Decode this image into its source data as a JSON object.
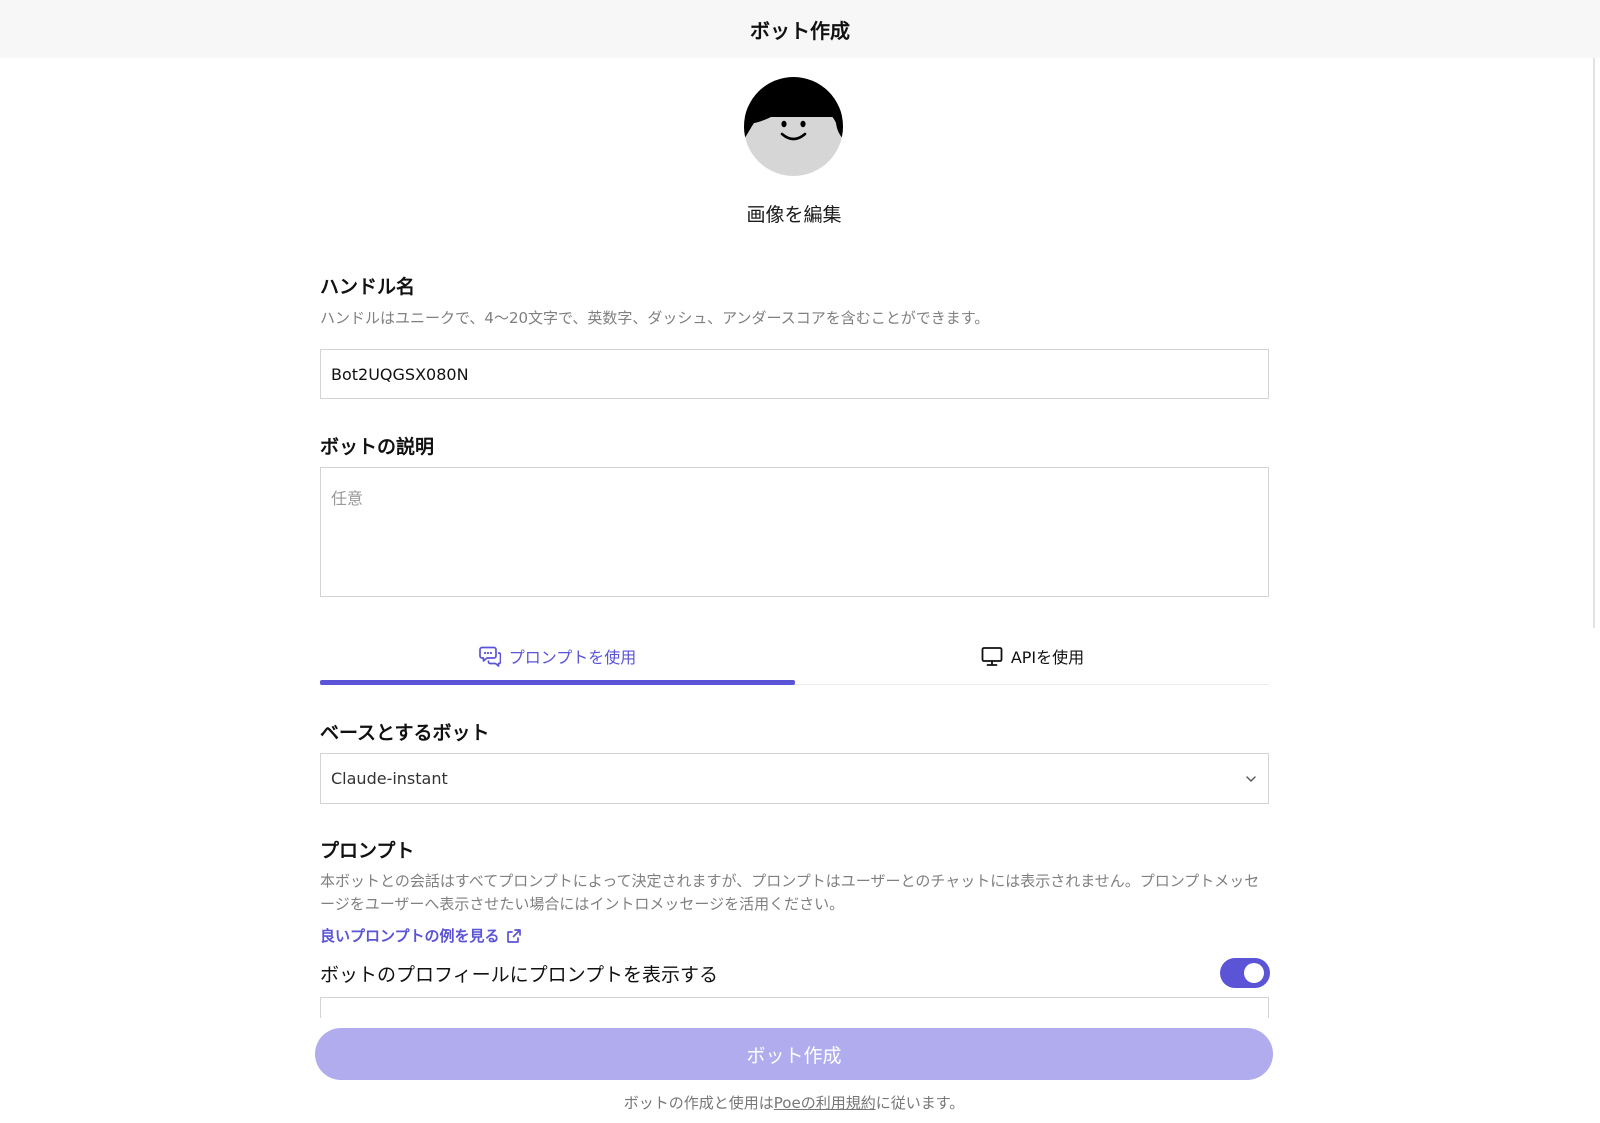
{
  "header": {
    "title": "ボット作成"
  },
  "avatar": {
    "edit_label": "画像を編集"
  },
  "handle": {
    "label": "ハンドル名",
    "hint": "ハンドルはユニークで、4〜20文字で、英数字、ダッシュ、アンダースコアを含むことができます。",
    "value": "Bot2UQGSX080N"
  },
  "description": {
    "label": "ボットの説明",
    "placeholder": "任意"
  },
  "tabs": [
    {
      "label": "プロンプトを使用",
      "icon": "chat-bubble-icon",
      "active": true
    },
    {
      "label": "APIを使用",
      "icon": "monitor-icon",
      "active": false
    }
  ],
  "base_bot": {
    "label": "ベースとするボット",
    "selected": "Claude-instant"
  },
  "prompt": {
    "label": "プロンプト",
    "hint": "本ボットとの会話はすべてプロンプトによって決定されますが、プロンプトはユーザーとのチャットには表示されません。プロンプトメッセージをユーザーへ表示させたい場合にはイントロメッセージを活用ください。",
    "examples_link": "良いプロンプトの例を見る",
    "show_on_profile_label": "ボットのプロフィールにプロンプトを表示する",
    "show_on_profile": true
  },
  "footer": {
    "create_button": "ボット作成",
    "terms_prefix": "ボットの作成と使用は",
    "terms_link": "Poeの利用規約",
    "terms_suffix": "に従います。"
  },
  "colors": {
    "accent": "#5b54d6",
    "button_disabled": "#b0aced",
    "header_bg": "#f7f7f7"
  }
}
